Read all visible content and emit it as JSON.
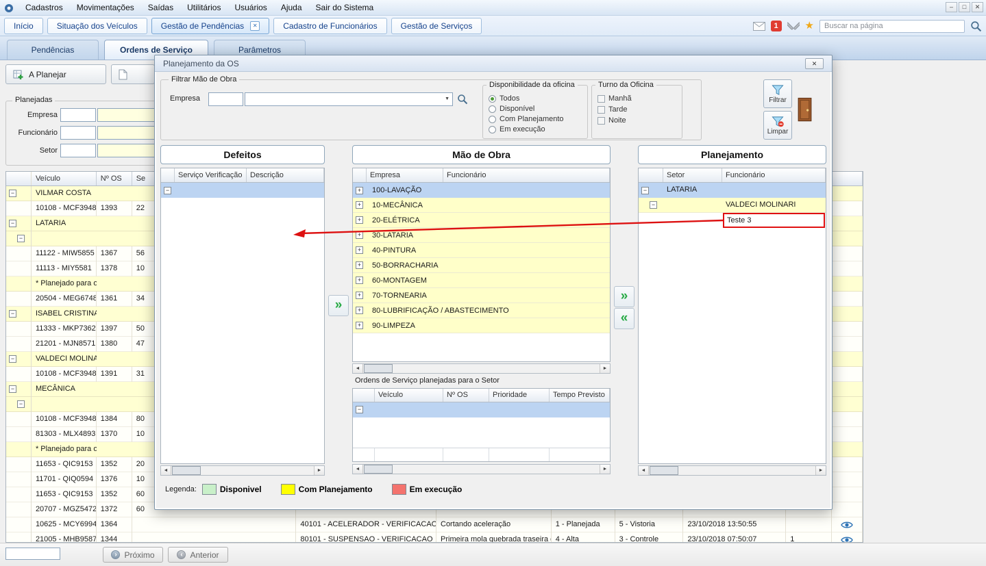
{
  "menubar": {
    "items": [
      {
        "label": "Cadastros"
      },
      {
        "label": "Movimentações"
      },
      {
        "label": "Saídas"
      },
      {
        "label": "Utilitários"
      },
      {
        "label": "Usuários"
      },
      {
        "label": "Ajuda"
      },
      {
        "label": "Sair do Sistema"
      }
    ]
  },
  "tabbar": {
    "tabs": [
      {
        "label": "Início"
      },
      {
        "label": "Situação dos Veículos"
      },
      {
        "label": "Gestão de Pendências"
      },
      {
        "label": "Cadastro de Funcionários"
      },
      {
        "label": "Gestão de Serviços"
      }
    ],
    "notification_count": "1",
    "search_placeholder": "Buscar na página"
  },
  "subtabs": {
    "pendencias": "Pendências",
    "ordens": "Ordens de Serviço",
    "parametros": "Parâmetros"
  },
  "toolbar": {
    "planejar_label": "A Planejar"
  },
  "planejadas": {
    "title": "Planejadas",
    "empresa_label": "Empresa",
    "funcionario_label": "Funcionário",
    "setor_label": "Setor"
  },
  "tree": {
    "headers": {
      "veiculo": "Veículo",
      "os": "Nº OS",
      "se": "Se"
    },
    "rows": [
      {
        "cls": "g",
        "expand": "−",
        "veiculo": "VILMAR COSTA"
      },
      {
        "cls": "d",
        "veiculo": "10108 - MCF3948",
        "os": "1393",
        "se": "22"
      },
      {
        "cls": "g",
        "expand": "−",
        "veiculo": "LATARIA"
      },
      {
        "cls": "g",
        "expand": "−",
        "indent": "lv1",
        "veiculo": ""
      },
      {
        "cls": "d",
        "veiculo": "11122 - MIW5855",
        "os": "1367",
        "se": "56"
      },
      {
        "cls": "d",
        "veiculo": "11113 - MIY5581",
        "os": "1378",
        "se": "10"
      },
      {
        "cls": "g",
        "veiculo": "* Planejado para o setor."
      },
      {
        "cls": "d",
        "veiculo": "20504 - MEG6748",
        "os": "1361",
        "se": "34"
      },
      {
        "cls": "g",
        "expand": "−",
        "veiculo": "ISABEL CRISTINA RIBEIRO"
      },
      {
        "cls": "d",
        "veiculo": "11333 - MKP7362",
        "os": "1397",
        "se": "50"
      },
      {
        "cls": "d",
        "veiculo": "21201 - MJN8571",
        "os": "1380",
        "se": "47"
      },
      {
        "cls": "g",
        "expand": "−",
        "veiculo": "VALDECI MOLINARI"
      },
      {
        "cls": "d",
        "veiculo": "10108 - MCF3948",
        "os": "1391",
        "se": "31"
      },
      {
        "cls": "g",
        "expand": "−",
        "veiculo": "MECÂNICA"
      },
      {
        "cls": "g",
        "expand": "−",
        "indent": "lv1",
        "veiculo": ""
      },
      {
        "cls": "d",
        "veiculo": "10108 - MCF3948",
        "os": "1384",
        "se": "80"
      },
      {
        "cls": "d",
        "veiculo": "81303 - MLX4893",
        "os": "1370",
        "se": "10"
      },
      {
        "cls": "g",
        "veiculo": "* Planejado para o setor."
      },
      {
        "cls": "d",
        "veiculo": "11653 - QIC9153",
        "os": "1352",
        "se": "20"
      },
      {
        "cls": "d",
        "veiculo": "11701 - QIQ0594",
        "os": "1376",
        "se": "10"
      },
      {
        "cls": "d",
        "veiculo": "11653 - QIC9153",
        "os": "1352",
        "se": "60"
      },
      {
        "cls": "d",
        "veiculo": "20707 - MGZ5472",
        "os": "1372",
        "se": "60"
      },
      {
        "cls": "d",
        "veiculo": "10625 - MCY6994",
        "os": "1364",
        "servico": "40101 - ACELERADOR - VERIFICACAO",
        "descricao": "Cortando aceleração",
        "status": "1 - Planejada",
        "tipo": "5 - Vistoria",
        "data": "23/10/2018 13:50:55",
        "eye": true
      },
      {
        "cls": "d",
        "veiculo": "21005 - MHB9587",
        "os": "1344",
        "servico": "80101 - SUSPENSAO - VERIFICACAO",
        "descricao": "Primeira mola quebrada traseira do",
        "status": "4 - Alta",
        "tipo": "3 - Controle",
        "data": "23/10/2018 07:50:07",
        "num": "1",
        "eye": true
      }
    ]
  },
  "bottombar": {
    "proximo": "Próximo",
    "anterior": "Anterior"
  },
  "dialog": {
    "title": "Planejamento da OS",
    "filter_group": {
      "title": "Filtrar Mão de Obra",
      "empresa_label": "Empresa"
    },
    "disponibilidade": {
      "title": "Disponibilidade da oficina",
      "options": [
        {
          "label": "Todos",
          "checked": true
        },
        {
          "label": "Disponível"
        },
        {
          "label": "Com Planejamento"
        },
        {
          "label": "Em execução"
        }
      ]
    },
    "turno": {
      "title": "Turno da Oficina",
      "options": [
        {
          "label": "Manhã"
        },
        {
          "label": "Tarde"
        },
        {
          "label": "Noite"
        }
      ]
    },
    "filtrar_button": "Filtrar",
    "limpar_button": "Limpar",
    "defeitos": {
      "title": "Defeitos",
      "headers": {
        "servico": "Serviço Verificação",
        "descricao": "Descrição"
      }
    },
    "mao_de_obra": {
      "title": "Mão de Obra",
      "headers": {
        "empresa": "Empresa",
        "funcionario": "Funcionário"
      },
      "rows": [
        {
          "label": "100-LAVAÇÃO",
          "cls": "sel",
          "expand": "+"
        },
        {
          "label": "10-MECÂNICA",
          "cls": "plan",
          "expand": "+"
        },
        {
          "label": "20-ELÉTRICA",
          "cls": "plan",
          "expand": "+"
        },
        {
          "label": "30-LATARIA",
          "cls": "plan",
          "expand": "+"
        },
        {
          "label": "40-PINTURA",
          "cls": "plan",
          "expand": "+"
        },
        {
          "label": "50-BORRACHARIA",
          "cls": "plan",
          "expand": "+"
        },
        {
          "label": "60-MONTAGEM",
          "cls": "plan",
          "expand": "+"
        },
        {
          "label": "70-TORNEARIA",
          "cls": "plan",
          "expand": "+"
        },
        {
          "label": "80-LUBRIFICAÇÃO / ABASTECIMENTO",
          "cls": "plan",
          "expand": "+"
        },
        {
          "label": "90-LIMPEZA",
          "cls": "plan",
          "expand": "+"
        }
      ]
    },
    "os_grid": {
      "title": "Ordens de Serviço planejadas para o Setor",
      "headers": [
        "Veículo",
        "Nº OS",
        "Prioridade",
        "Tempo Previsto"
      ]
    },
    "planejamento": {
      "title": "Planejamento",
      "headers": {
        "setor": "Setor",
        "funcionario": "Funcionário"
      },
      "selected_setor": "LATARIA",
      "funcionario_row": "VALDECI MOLINARI",
      "highlighted_entry": "Teste 3"
    },
    "legend": {
      "label": "Legenda:",
      "items": [
        {
          "label": "Disponivel",
          "color": "#c9f0c9"
        },
        {
          "label": "Com Planejamento",
          "color": "#ffff00"
        },
        {
          "label": "Em execução",
          "color": "#f4736e"
        }
      ]
    }
  },
  "icons": {
    "close": "✕",
    "minimize": "–",
    "maximize": "□",
    "collapse": "−",
    "expand": "+",
    "dropdown": "▼",
    "double_right": "»",
    "double_left": "«",
    "scroll_left": "◄",
    "scroll_right": "►",
    "star": "★",
    "prev_arrow": "‹",
    "next_arrow": "›"
  },
  "colors": {
    "selection": "#bcd4f2",
    "planned_row": "#ffffc9",
    "group_row": "#ffffd2",
    "annotation_red": "#e01010",
    "transfer_green": "#27aa45",
    "badge_red": "#e03c32",
    "star_yellow": "#f0a818",
    "legend_green": "#c9f0c9",
    "legend_yellow": "#ffff00",
    "legend_red": "#f4736e"
  }
}
